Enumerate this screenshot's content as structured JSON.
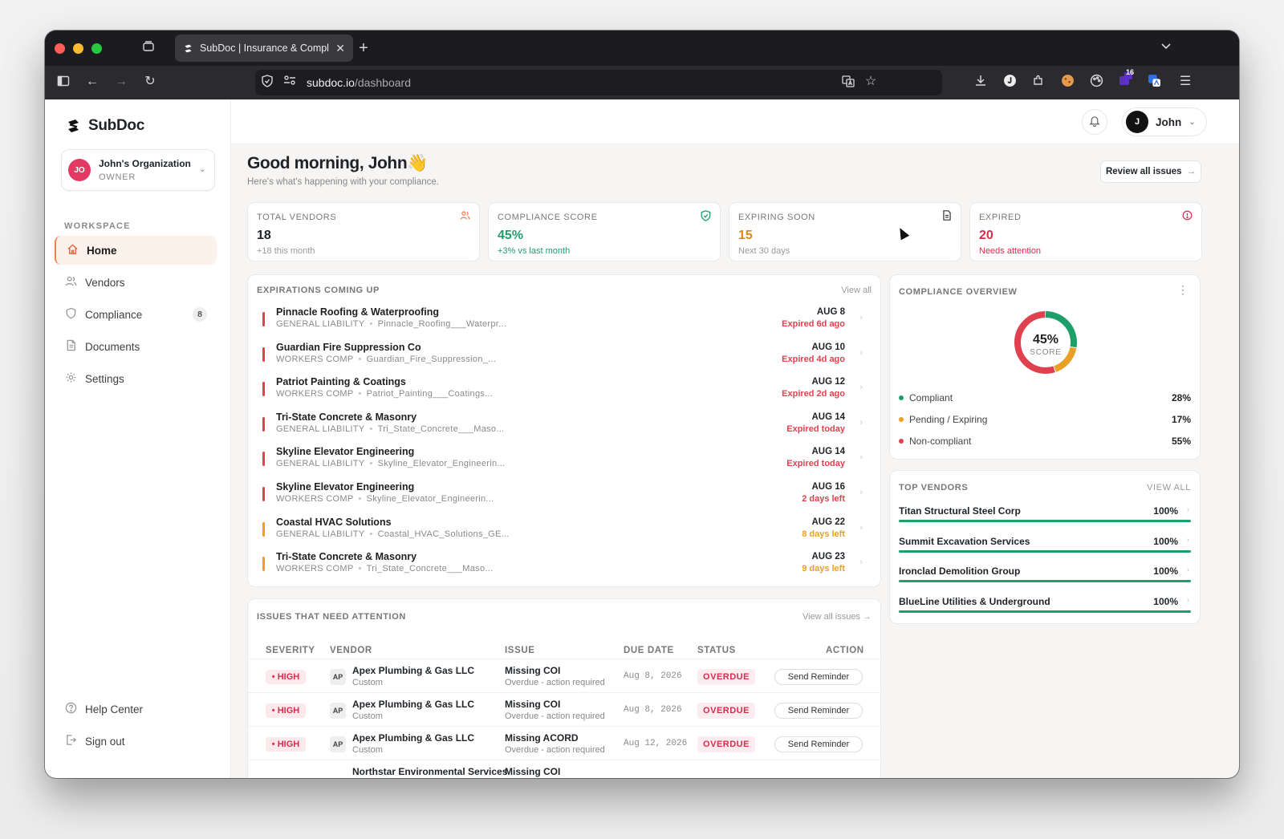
{
  "browser": {
    "tab_title": "SubDoc | Insurance & Complian",
    "url_host": "subdoc.io",
    "url_path": "/dashboard",
    "ext_badge": "16"
  },
  "app": {
    "brand": "SubDoc",
    "org": {
      "initials": "JO",
      "name": "John's Organization",
      "role": "OWNER"
    },
    "workspace_label": "WORKSPACE",
    "nav": [
      {
        "label": "Home",
        "icon": "home-icon",
        "active": true
      },
      {
        "label": "Vendors",
        "icon": "users-icon"
      },
      {
        "label": "Compliance",
        "icon": "shield-icon",
        "badge": "8"
      },
      {
        "label": "Documents",
        "icon": "document-icon"
      },
      {
        "label": "Settings",
        "icon": "gear-icon"
      }
    ],
    "footer_nav": [
      {
        "label": "Help Center",
        "icon": "help-icon"
      },
      {
        "label": "Sign out",
        "icon": "signout-icon"
      }
    ]
  },
  "header": {
    "user_initial": "J",
    "user_name": "John"
  },
  "greeting": {
    "title": "Good morning, John👋",
    "subtitle": "Here's what's happening with your compliance.",
    "review_button": "Review all issues"
  },
  "stats": [
    {
      "label": "TOTAL VENDORS",
      "value": "18",
      "sub": "+18 this month",
      "color": "#1f2328",
      "sub_color": "#999999"
    },
    {
      "label": "COMPLIANCE SCORE",
      "value": "45%",
      "sub": "+3% vs last month",
      "color": "#1d9f6b",
      "sub_color": "#1d9f6b"
    },
    {
      "label": "EXPIRING SOON",
      "value": "15",
      "sub": "Next 30 days",
      "color": "#d98a12",
      "sub_color": "#999999"
    },
    {
      "label": "EXPIRED",
      "value": "20",
      "sub": "Needs attention",
      "color": "#d92c4d",
      "sub_color": "#d92c4d"
    }
  ],
  "expirations": {
    "title": "EXPIRATIONS COMING UP",
    "view_all": "View all",
    "rows": [
      {
        "name": "Pinnacle Roofing & Waterproofing",
        "type": "GENERAL LIABILITY",
        "file": "Pinnacle_Roofing___Waterpr...",
        "date": "AUG 8",
        "status": "Expired 6d ago",
        "tone": "red"
      },
      {
        "name": "Guardian Fire Suppression Co",
        "type": "WORKERS COMP",
        "file": "Guardian_Fire_Suppression_...",
        "date": "AUG 10",
        "status": "Expired 4d ago",
        "tone": "red"
      },
      {
        "name": "Patriot Painting & Coatings",
        "type": "WORKERS COMP",
        "file": "Patriot_Painting___Coatings...",
        "date": "AUG 12",
        "status": "Expired 2d ago",
        "tone": "red"
      },
      {
        "name": "Tri-State Concrete & Masonry",
        "type": "GENERAL LIABILITY",
        "file": "Tri_State_Concrete___Maso...",
        "date": "AUG 14",
        "status": "Expired today",
        "tone": "red"
      },
      {
        "name": "Skyline Elevator Engineering",
        "type": "GENERAL LIABILITY",
        "file": "Skyline_Elevator_Engineerin...",
        "date": "AUG 14",
        "status": "Expired today",
        "tone": "red"
      },
      {
        "name": "Skyline Elevator Engineering",
        "type": "WORKERS COMP",
        "file": "Skyline_Elevator_Engineerin...",
        "date": "AUG 16",
        "status": "2 days left",
        "tone": "red"
      },
      {
        "name": "Coastal HVAC Solutions",
        "type": "GENERAL LIABILITY",
        "file": "Coastal_HVAC_Solutions_GE...",
        "date": "AUG 22",
        "status": "8 days left",
        "tone": "amber"
      },
      {
        "name": "Tri-State Concrete & Masonry",
        "type": "WORKERS COMP",
        "file": "Tri_State_Concrete___Maso...",
        "date": "AUG 23",
        "status": "9 days left",
        "tone": "amber"
      }
    ]
  },
  "overview": {
    "title": "COMPLIANCE OVERVIEW",
    "score": "45%",
    "score_label": "SCORE",
    "segments": [
      {
        "label": "Compliant",
        "pct": "28%",
        "value": 28,
        "color": "#1d9f6b"
      },
      {
        "label": "Pending / Expiring",
        "pct": "17%",
        "value": 17,
        "color": "#e9a023"
      },
      {
        "label": "Non-compliant",
        "pct": "55%",
        "value": 55,
        "color": "#e0414f"
      }
    ]
  },
  "top_vendors": {
    "title": "TOP VENDORS",
    "view_all": "VIEW ALL",
    "rows": [
      {
        "name": "Titan Structural Steel Corp",
        "pct": "100%",
        "score": 1.0
      },
      {
        "name": "Summit Excavation Services",
        "pct": "100%",
        "score": 1.0
      },
      {
        "name": "Ironclad Demolition Group",
        "pct": "100%",
        "score": 1.0
      },
      {
        "name": "BlueLine Utilities & Underground",
        "pct": "100%",
        "score": 1.0
      }
    ]
  },
  "issues": {
    "title": "ISSUES THAT NEED ATTENTION",
    "view_all": "View all issues",
    "columns": [
      "SEVERITY",
      "VENDOR",
      "ISSUE",
      "DUE DATE",
      "STATUS",
      "ACTION"
    ],
    "rows": [
      {
        "severity": "• HIGH",
        "initials": "AP",
        "vendor": "Apex Plumbing & Gas LLC",
        "vendor_sub": "Custom",
        "issue": "Missing COI",
        "issue_sub": "Overdue - action required",
        "due": "Aug 8, 2026",
        "status": "OVERDUE",
        "action": "Send Reminder"
      },
      {
        "severity": "• HIGH",
        "initials": "AP",
        "vendor": "Apex Plumbing & Gas LLC",
        "vendor_sub": "Custom",
        "issue": "Missing COI",
        "issue_sub": "Overdue - action required",
        "due": "Aug 8, 2026",
        "status": "OVERDUE",
        "action": "Send Reminder"
      },
      {
        "severity": "• HIGH",
        "initials": "AP",
        "vendor": "Apex Plumbing & Gas LLC",
        "vendor_sub": "Custom",
        "issue": "Missing ACORD",
        "issue_sub": "Overdue - action required",
        "due": "Aug 12, 2026",
        "status": "OVERDUE",
        "action": "Send Reminder"
      },
      {
        "severity": "",
        "initials": "",
        "vendor": "Northstar Environmental Services",
        "vendor_sub": "",
        "issue": "Missing COI",
        "issue_sub": "",
        "due": "",
        "status": "",
        "action": ""
      }
    ]
  }
}
